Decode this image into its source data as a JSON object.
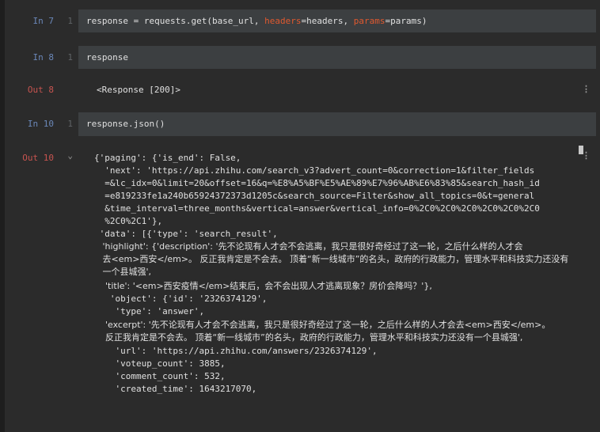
{
  "cells": [
    {
      "in_label": "In 7",
      "line_no": "1",
      "code_parts": [
        {
          "text": "response = requests.get(base_url, ",
          "type": "plain"
        },
        {
          "text": "headers",
          "type": "param"
        },
        {
          "text": "=headers, ",
          "type": "plain"
        },
        {
          "text": "params",
          "type": "param"
        },
        {
          "text": "=params)",
          "type": "plain"
        }
      ]
    },
    {
      "in_label": "In 8",
      "line_no": "1",
      "code": "response",
      "out_label": "Out 8",
      "output": "<Response [200]>"
    },
    {
      "in_label": "In 10",
      "line_no": "1",
      "code": "response.json()",
      "out_label": "Out 10",
      "collapse_icon": "⌄"
    }
  ],
  "json_output": [
    "{'paging': {'is_end': False,",
    "  'next': 'https://api.zhihu.com/search_v3?advert_count=0&correction=1&filter_fields",
    "  =&lc_idx=0&limit=20&offset=16&q=%E8%A5%BF%E5%AE%89%E7%96%AB%E6%83%85&search_hash_id",
    "  =e819233fe1a240b65924372373d1205c&search_source=Filter&show_all_topics=0&t=general",
    "  &time_interval=three_months&vertical=answer&vertical_info=0%2C0%2C0%2C0%2C0%2C0%2C0",
    "  %2C0%2C1'},",
    " 'data': [{'type': 'search_result',",
    "   'highlight': {'description': '先不论现有人才会不会逃离，我只是很好奇经过了这一轮，之后什么样的人才会",
    "   去<em>西安</em>。 反正我肯定是不会去。 顶着“新一线城市”的名头，政府的行政能力，管理水平和科技实力还没有",
    "   一个县城强',",
    "    'title': '<em>西安疫情</em>结束后，会不会出现人才逃离现象？房价会降吗？'},",
    "   'object': {'id': '2326374129',",
    "    'type': 'answer',",
    "    'excerpt': '先不论现有人才会不会逃离，我只是很好奇经过了这一轮，之后什么样的人才会去<em>西安</em>。",
    "    反正我肯定是不会去。 顶着“新一线城市”的名头，政府的行政能力，管理水平和科技实力还没有一个县城强',",
    "    'url': 'https://api.zhihu.com/answers/2326374129',",
    "    'voteup_count': 3885,",
    "    'comment_count': 532,",
    "    'created_time': 1643217070,"
  ],
  "menu_icon": "⋮",
  "colors": {
    "background": "#2b2b2b",
    "code_box": "#3c3f41",
    "in_label": "#6a87b8",
    "out_label": "#c75450",
    "param_keyword": "#e0592f"
  }
}
